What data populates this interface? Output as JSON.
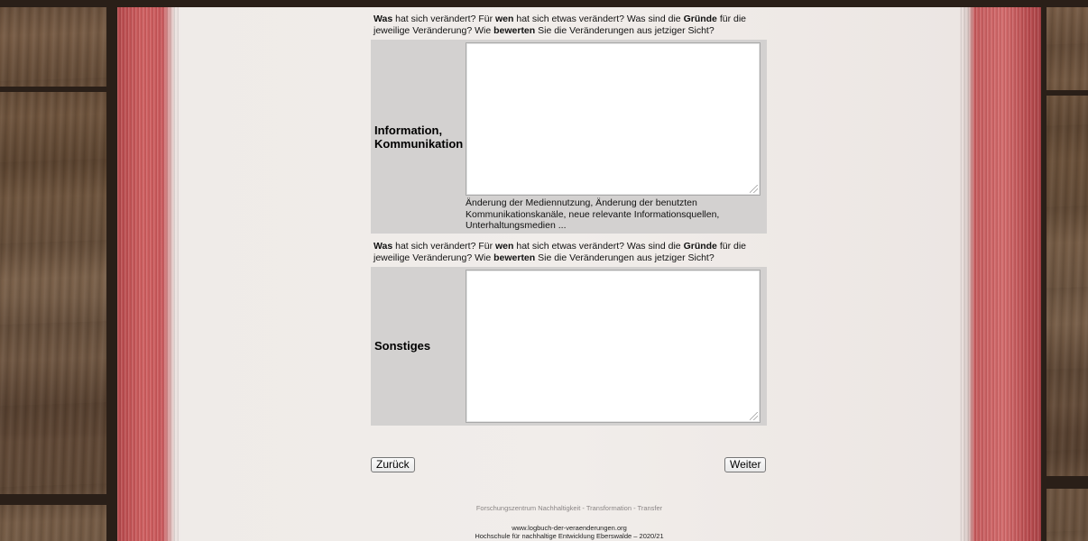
{
  "sections": [
    {
      "intro_parts": [
        "Was",
        " hat sich verändert? Für ",
        "wen",
        " hat sich etwas verändert? Was sind die ",
        "Gründe",
        " für die jeweilige Veränderung? Wie ",
        "bewerten",
        " Sie die Veränderungen aus jetziger Sicht?"
      ],
      "label": "Information, Kommunikation",
      "textarea_value": "",
      "hint": "Änderung der Mediennutzung, Änderung der benutzten Kommunikationskanäle, neue relevante Informationsquellen, Unterhaltungsmedien ..."
    },
    {
      "intro_parts": [
        "Was",
        " hat sich verändert? Für ",
        "wen",
        " hat sich etwas verändert? Was sind die ",
        "Gründe",
        " für die jeweilige Veränderung? Wie ",
        "bewerten",
        " Sie die Veränderungen aus jetziger Sicht?"
      ],
      "label": "Sonstiges",
      "textarea_value": ""
    }
  ],
  "buttons": {
    "back": "Zurück",
    "next": "Weiter"
  },
  "footer": {
    "line1": "Forschungszentrum Nachhaltigkeit - Transformation - Transfer",
    "line2": "www.logbuch-der-veraenderungen.org",
    "line3": "Hochschule für nachhaltige Entwicklung Eberswalde – 2020/21"
  }
}
